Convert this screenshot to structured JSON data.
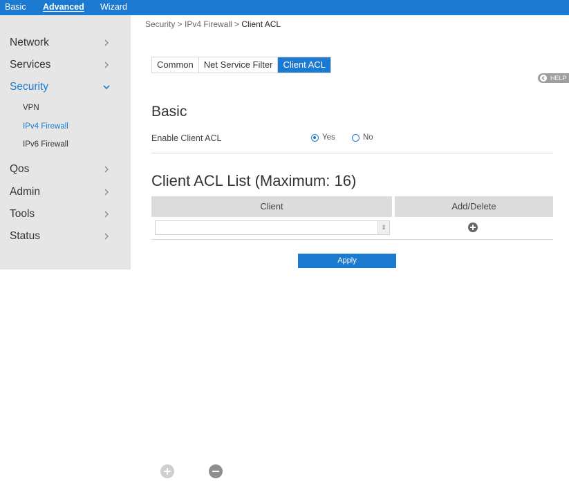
{
  "topnav": {
    "items": [
      "Basic",
      "Advanced",
      "Wizard"
    ],
    "active": "Advanced"
  },
  "sidebar": {
    "items": [
      {
        "label": "Network"
      },
      {
        "label": "Services"
      },
      {
        "label": "Security",
        "expanded": true
      },
      {
        "label": "Qos"
      },
      {
        "label": "Admin"
      },
      {
        "label": "Tools"
      },
      {
        "label": "Status"
      }
    ],
    "security_subitems": [
      "VPN",
      "IPv4 Firewall",
      "IPv6 Firewall"
    ],
    "active_subitem": "IPv4 Firewall"
  },
  "breadcrumb": {
    "path": "Security > IPv4 Firewall > ",
    "current": "Client ACL"
  },
  "tabs": [
    "Common",
    "Net Service Filter",
    "Client ACL"
  ],
  "active_tab": "Client ACL",
  "help_label": "HELP",
  "basic": {
    "title": "Basic",
    "enable_label": "Enable Client ACL",
    "options": [
      "Yes",
      "No"
    ],
    "selected": "Yes"
  },
  "acl_list": {
    "title": "Client ACL List (Maximum: 16)",
    "columns": [
      "Client",
      "Add/Delete"
    ],
    "rows": [
      {
        "client": ""
      }
    ]
  },
  "apply_label": "Apply",
  "icons": {
    "spinner": "updown-icon",
    "add": "plus-circle-icon",
    "remove": "minus-circle-icon",
    "help": "help-icon"
  },
  "colors": {
    "accent": "#1c7ad0",
    "sidebar_bg": "#e6e6e6",
    "header_bg": "#dcdcdc"
  }
}
